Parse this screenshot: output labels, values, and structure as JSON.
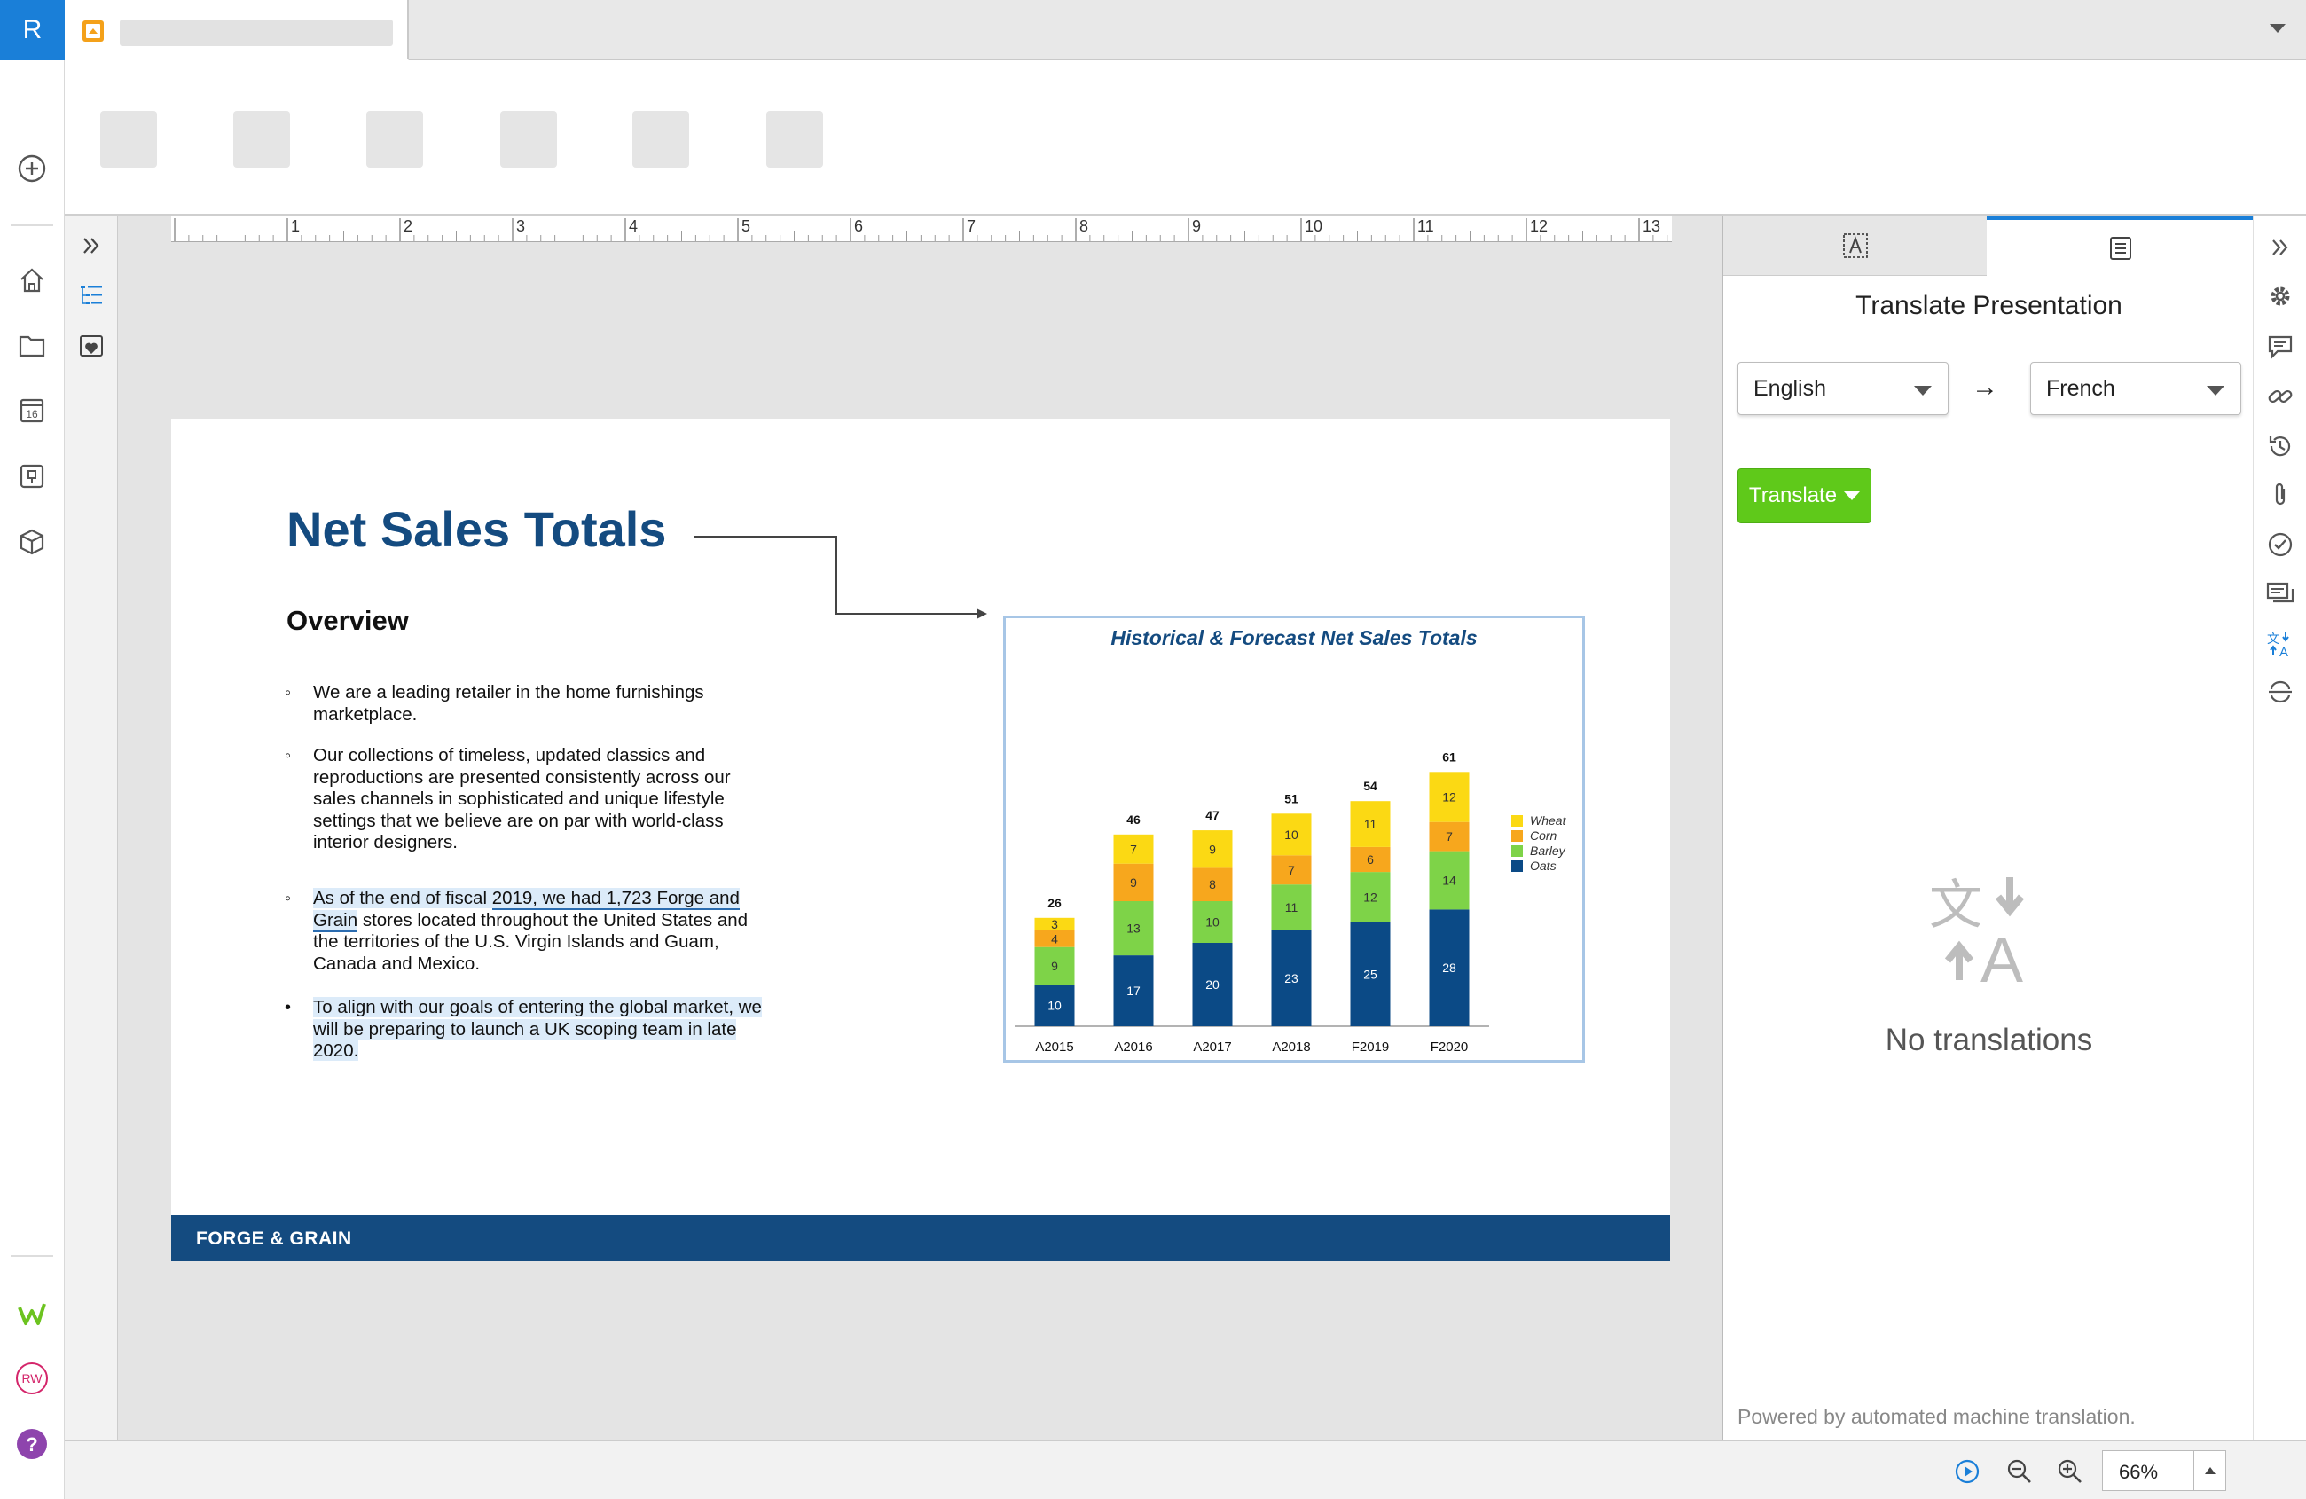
{
  "app": {
    "logo_letter": "R"
  },
  "rail": {
    "icons": [
      "add-circle-icon",
      "home-icon",
      "folder-icon",
      "calendar-icon",
      "reports-icon",
      "box-icon",
      "workiva-icon",
      "rw-icon",
      "help-icon"
    ],
    "calendar_day": "16",
    "rw_label": "RW",
    "help_label": "?"
  },
  "doc_panel": {
    "icons": [
      "expand-chevrons-icon",
      "outline-icon",
      "favorite-icon"
    ]
  },
  "ruler": {
    "numbers": [
      "1",
      "2",
      "3",
      "4",
      "5",
      "6",
      "7",
      "8",
      "9",
      "10",
      "11",
      "12",
      "13"
    ]
  },
  "slide": {
    "title": "Net Sales Totals",
    "overview": "Overview",
    "bullets": [
      {
        "text": "We are a leading retailer in the home furnishings marketplace."
      },
      {
        "text": "Our collections of timeless, updated classics and reproductions are presented consistently across our sales channels in sophisticated and unique lifestyle settings that we believe are on par with world-class interior designers."
      },
      {
        "pre": " As of the end of fiscal ",
        "link": "2019, we had 1,723 Forge and Grain",
        "post": " stores located throughout the United States and the territories of the U.S. Virgin Islands and Guam, Canada and Mexico."
      },
      {
        "text": "To align with our goals of entering the global market, we will be preparing to launch a UK scoping team in late 2020."
      }
    ],
    "footer": "FORGE & GRAIN"
  },
  "chart_data": {
    "type": "bar",
    "stacked": true,
    "title": "Historical & Forecast Net Sales Totals",
    "categories": [
      "A2015",
      "A2016",
      "A2017",
      "A2018",
      "F2019",
      "F2020"
    ],
    "series": [
      {
        "name": "Oats",
        "values": [
          10,
          17,
          20,
          23,
          25,
          28
        ],
        "color": "#0b4a86"
      },
      {
        "name": "Barley",
        "values": [
          9,
          13,
          10,
          11,
          12,
          14
        ],
        "color": "#7ed348"
      },
      {
        "name": "Corn",
        "values": [
          4,
          9,
          8,
          7,
          6,
          7
        ],
        "color": "#f7a71d"
      },
      {
        "name": "Wheat",
        "values": [
          3,
          7,
          9,
          10,
          11,
          12
        ],
        "color": "#fbd914"
      }
    ],
    "totals": [
      26,
      46,
      47,
      51,
      54,
      61
    ],
    "legend": "right",
    "legend_order": [
      "Wheat",
      "Corn",
      "Barley",
      "Oats"
    ]
  },
  "right_panel": {
    "tabs": [
      "text-format-icon",
      "notes-icon"
    ],
    "title": "Translate Presentation",
    "source_language": "English",
    "target_language": "French",
    "arrow": "→",
    "translate_button": "Translate",
    "empty_message": "No translations",
    "footnote": "Powered by automated machine translation."
  },
  "right_rail": {
    "icons": [
      "expand-chevrons-icon",
      "gear-icon",
      "comment-icon",
      "link-icon",
      "history-icon",
      "attachment-icon",
      "check-circle-icon",
      "comments-list-icon",
      "translate-icon",
      "sync-icon"
    ]
  },
  "status": {
    "zoom": "66%"
  }
}
